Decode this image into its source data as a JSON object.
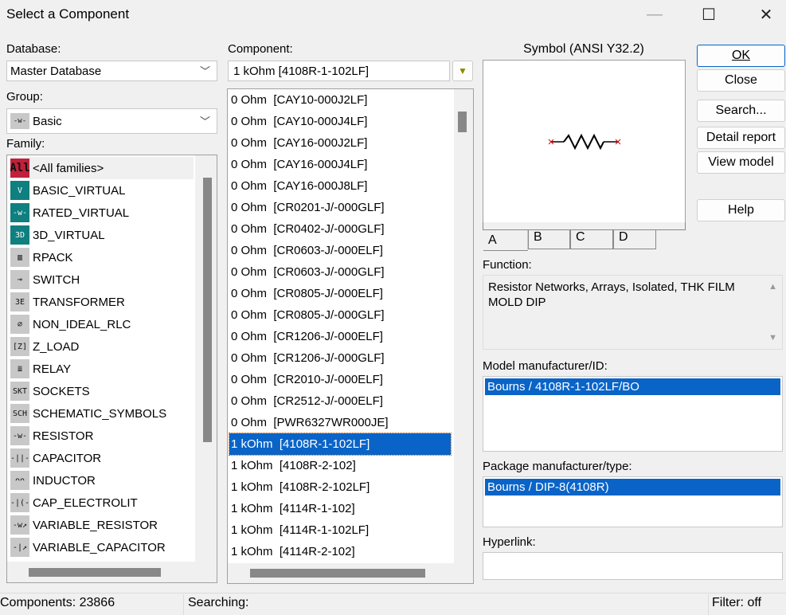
{
  "window": {
    "title": "Select a Component",
    "minimize": "—",
    "maximize": "☐",
    "close": "✕"
  },
  "database": {
    "label": "Database:",
    "value": "Master Database"
  },
  "group": {
    "label": "Group:",
    "value": "Basic",
    "icon": "resistor-icon"
  },
  "family": {
    "label": "Family:",
    "items": [
      {
        "label": "<All families>",
        "icon": "All"
      },
      {
        "label": "BASIC_VIRTUAL",
        "icon": "V"
      },
      {
        "label": "RATED_VIRTUAL",
        "icon": "-w-"
      },
      {
        "label": "3D_VIRTUAL",
        "icon": "3D"
      },
      {
        "label": "RPACK",
        "icon": "▥"
      },
      {
        "label": "SWITCH",
        "icon": "⊸"
      },
      {
        "label": "TRANSFORMER",
        "icon": "3E"
      },
      {
        "label": "NON_IDEAL_RLC",
        "icon": "⌀"
      },
      {
        "label": "Z_LOAD",
        "icon": "[Z]"
      },
      {
        "label": "RELAY",
        "icon": "≣"
      },
      {
        "label": "SOCKETS",
        "icon": "SKT"
      },
      {
        "label": "SCHEMATIC_SYMBOLS",
        "icon": "SCH"
      },
      {
        "label": "RESISTOR",
        "icon": "-w-"
      },
      {
        "label": "CAPACITOR",
        "icon": "-||-"
      },
      {
        "label": "INDUCTOR",
        "icon": "ᴖᴖ"
      },
      {
        "label": "CAP_ELECTROLIT",
        "icon": "-|(-"
      },
      {
        "label": "VARIABLE_RESISTOR",
        "icon": "-w↗"
      },
      {
        "label": "VARIABLE_CAPACITOR",
        "icon": "-|↗"
      }
    ]
  },
  "component": {
    "label": "Component:",
    "value": "1 kOhm  [4108R-1-102LF]",
    "filter_icon": "filter-icon",
    "items": [
      "0 Ohm  [CAY10-000J2LF]",
      "0 Ohm  [CAY10-000J4LF]",
      "0 Ohm  [CAY16-000J2LF]",
      "0 Ohm  [CAY16-000J4LF]",
      "0 Ohm  [CAY16-000J8LF]",
      "0 Ohm  [CR0201-J/-000GLF]",
      "0 Ohm  [CR0402-J/-000GLF]",
      "0 Ohm  [CR0603-J/-000ELF]",
      "0 Ohm  [CR0603-J/-000GLF]",
      "0 Ohm  [CR0805-J/-000ELF]",
      "0 Ohm  [CR0805-J/-000GLF]",
      "0 Ohm  [CR1206-J/-000ELF]",
      "0 Ohm  [CR1206-J/-000GLF]",
      "0 Ohm  [CR2010-J/-000ELF]",
      "0 Ohm  [CR2512-J/-000ELF]",
      "0 Ohm  [PWR6327WR000JE]",
      "1 kOhm  [4108R-1-102LF]",
      "1 kOhm  [4108R-2-102]",
      "1 kOhm  [4108R-2-102LF]",
      "1 kOhm  [4114R-1-102]",
      "1 kOhm  [4114R-1-102LF]",
      "1 kOhm  [4114R-2-102]"
    ],
    "selected_index": 16
  },
  "symbol": {
    "label": "Symbol (ANSI Y32.2)",
    "tabs": [
      "A",
      "B",
      "C",
      "D"
    ],
    "active_tab": "A"
  },
  "function": {
    "label": "Function:",
    "text": "Resistor Networks, Arrays, Isolated, THK FILM MOLD DIP"
  },
  "model": {
    "label": "Model manufacturer/ID:",
    "items": [
      "Bourns / 4108R-1-102LF/BO"
    ]
  },
  "package": {
    "label": "Package manufacturer/type:",
    "items": [
      "Bourns / DIP-8(4108R)"
    ]
  },
  "hyperlink": {
    "label": "Hyperlink:",
    "value": ""
  },
  "buttons": {
    "ok": "OK",
    "close": "Close",
    "search": "Search...",
    "detail": "Detail report",
    "view": "View model",
    "help": "Help"
  },
  "status": {
    "components": "Components: 23866",
    "searching": "Searching:",
    "filter": "Filter: off"
  },
  "colors": {
    "selection": "#0a64c8",
    "all_icon": "#c0203a",
    "virtual_icon": "#0f7f7f"
  }
}
